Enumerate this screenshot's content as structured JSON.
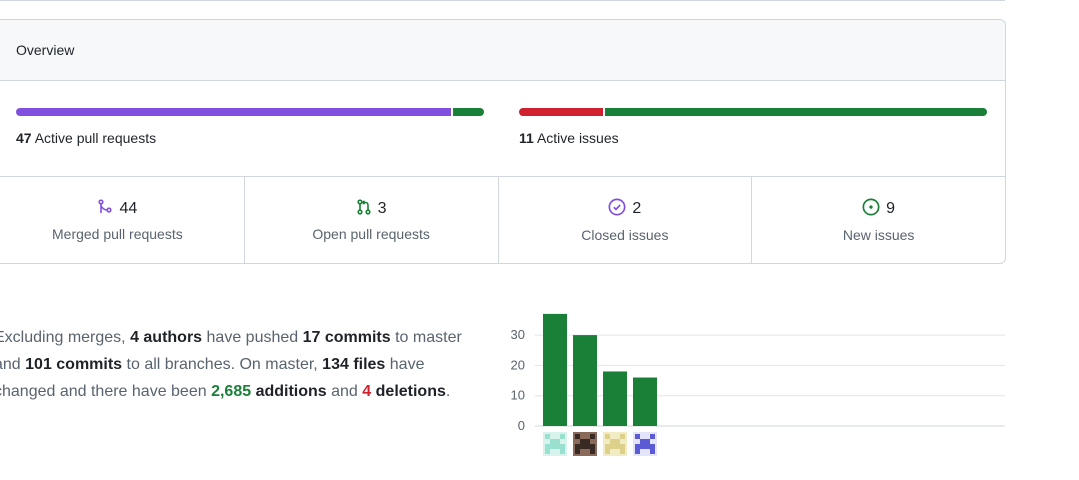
{
  "overview": {
    "title": "Overview",
    "pull_requests": {
      "count": "47",
      "label": "Active pull requests",
      "merged_fraction": 0.933,
      "open_fraction": 0.067
    },
    "issues": {
      "count": "11",
      "label": "Active issues",
      "closed_fraction": 0.18,
      "new_fraction": 0.82
    },
    "stats": [
      {
        "count": "44",
        "label": "Merged pull requests",
        "icon": "merge-icon",
        "color": "#8250df"
      },
      {
        "count": "3",
        "label": "Open pull requests",
        "icon": "pull-request-icon",
        "color": "#1a7f37"
      },
      {
        "count": "2",
        "label": "Closed issues",
        "icon": "issue-closed-icon",
        "color": "#8250df"
      },
      {
        "count": "9",
        "label": "New issues",
        "icon": "issue-opened-icon",
        "color": "#1a7f37"
      }
    ]
  },
  "summary": {
    "t1": "Excluding merges, ",
    "authors": "4 authors",
    "t2": " have pushed ",
    "commits": "17 commits",
    "t3": " to master and ",
    "all_commits": "101 commits",
    "t4": " to all branches. On master, ",
    "files": "134 files",
    "t5": " have changed and there have been ",
    "additions_num": "2,685",
    "additions_word": "additions",
    "t6": " and ",
    "deletions_num": "4",
    "deletions_word": "deletions",
    "t7": "."
  },
  "colors": {
    "merged": "#8250df",
    "open": "#1a7f37",
    "closed": "#cf222e",
    "new": "#1a7f37",
    "bar": "#1a7f37"
  },
  "chart_data": {
    "type": "bar",
    "categories": [
      "author-1",
      "author-2",
      "author-3",
      "author-4"
    ],
    "values": [
      37,
      30,
      18,
      16
    ],
    "ylim": [
      0,
      30
    ],
    "yticks": [
      "0",
      "10",
      "20",
      "30"
    ],
    "grid": true
  }
}
